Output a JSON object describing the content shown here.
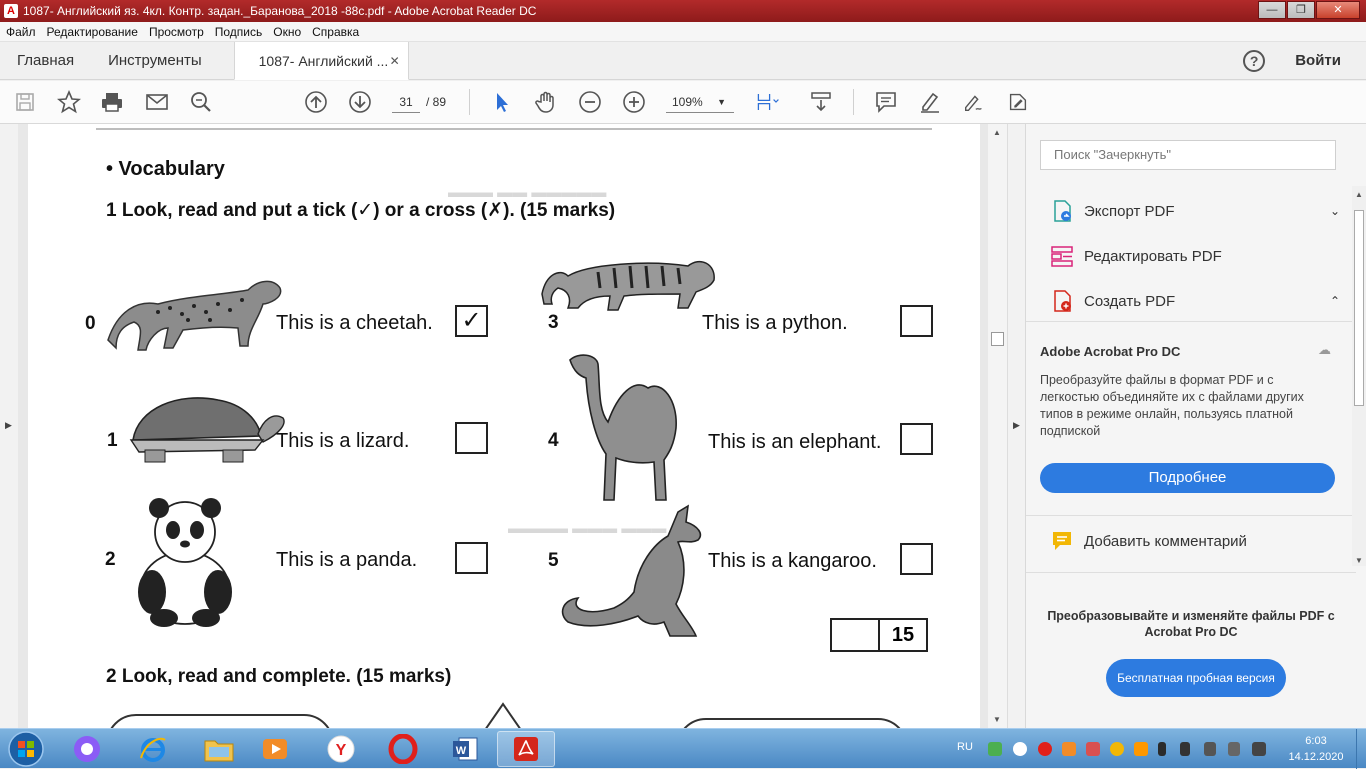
{
  "window": {
    "title": "1087- Английский яз. 4кл. Контр. задан._Баранова_2018 -88с.pdf - Adobe Acrobat Reader DC",
    "controls": {
      "minimize": "—",
      "maximize": "❐",
      "close": "✕"
    }
  },
  "menu": [
    "Файл",
    "Редактирование",
    "Просмотр",
    "Подпись",
    "Окно",
    "Справка"
  ],
  "tabs": {
    "home": "Главная",
    "tools": "Инструменты",
    "document": "1087- Английский ...",
    "close": "✕",
    "help": "?",
    "signin": "Войти"
  },
  "toolbar": {
    "page_current": "31",
    "page_total": "/  89",
    "zoom": "109%",
    "zoom_caret": "▼"
  },
  "document": {
    "section": "•  Vocabulary",
    "task1": "1   Look, read and put a tick (✓) or a cross (✗). (15 marks)",
    "items": [
      {
        "num": "0",
        "text": "This is a cheetah.",
        "mark": "✓"
      },
      {
        "num": "1",
        "text": "This is a lizard.",
        "mark": ""
      },
      {
        "num": "2",
        "text": "This is a panda.",
        "mark": ""
      },
      {
        "num": "3",
        "text": "This is a python.",
        "mark": ""
      },
      {
        "num": "4",
        "text": "This is an elephant.",
        "mark": ""
      },
      {
        "num": "5",
        "text": "This is a kangaroo.",
        "mark": ""
      }
    ],
    "score": "15",
    "task2": "2   Look, read and complete. (15 marks)"
  },
  "right_panel": {
    "search_placeholder": "Поиск \"Зачеркнуть\"",
    "tools": [
      {
        "label": "Экспорт PDF",
        "chevron": "⌄"
      },
      {
        "label": "Редактировать PDF",
        "chevron": ""
      },
      {
        "label": "Создать PDF",
        "chevron": "⌃"
      }
    ],
    "promo": {
      "title": "Adobe Acrobat Pro DC",
      "text": "Преобразуйте файлы в формат PDF и с легкостью объединяйте их с файлами других типов в режиме онлайн, пользуясь платной подпиской",
      "button": "Подробнее"
    },
    "comment": "Добавить комментарий",
    "trial": {
      "title": "Преобразовывайте и изменяйте файлы PDF с Acrobat Pro DC",
      "button": "Бесплатная пробная версия"
    }
  },
  "taskbar": {
    "lang": "RU",
    "time": "6:03",
    "date": "14.12.2020"
  },
  "colors": {
    "accent": "#2d7be0",
    "titlebar": "#b22a2a",
    "acrobat_red": "#d4271b"
  }
}
